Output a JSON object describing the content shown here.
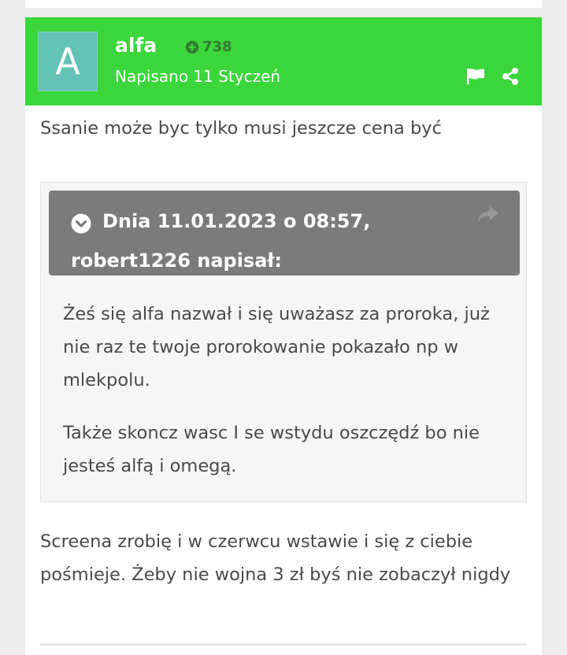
{
  "post": {
    "avatar_letter": "A",
    "author": "alfa",
    "reputation": "738",
    "date": "Napisano 11 Styczeń",
    "body_first": "Ssanie może byc tylko musi jeszcze cena być",
    "quote": {
      "header": "Dnia 11.01.2023 o 08:57, robert1226 napisał:",
      "para1": "Żeś się alfa nazwał i się uważasz za proroka, już nie raz te twoje prorokowanie pokazało np w mlekpolu.",
      "para2": "Także skoncz wasc I se wstydu oszczędź bo nie jesteś alfą i omegą."
    },
    "body_second": "Screena zrobię i w czerwcu wstawie i się z ciebie pośmieje.  Żeby nie wojna 3 zł byś nie zobaczył nigdy"
  },
  "icons": {
    "reputation": "plus-circle-icon",
    "report": "flag-icon",
    "share": "share-icon",
    "quote_toggle": "chevron-down-circle-icon",
    "quote_link": "reply-arrow-icon"
  },
  "colors": {
    "header_bg": "#3bd63b",
    "avatar_bg": "#64c2b6",
    "reputation": "#2f7c2f",
    "quote_header_bg": "#7b7b7b",
    "text": "#4a4a4a"
  }
}
